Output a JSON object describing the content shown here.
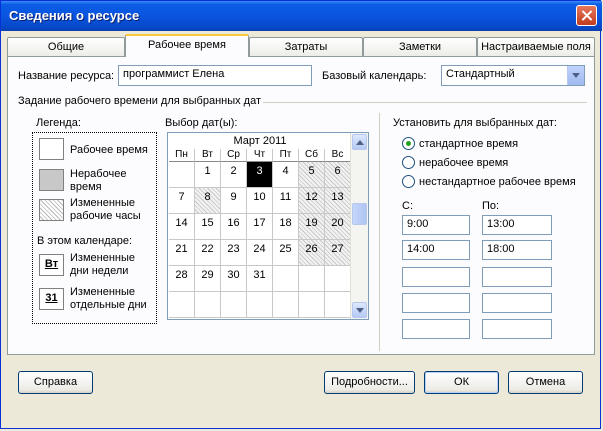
{
  "window": {
    "title": "Сведения о ресурсе"
  },
  "tabs": [
    {
      "label": "Общие"
    },
    {
      "label": "Рабочее время"
    },
    {
      "label": "Затраты"
    },
    {
      "label": "Заметки"
    },
    {
      "label": "Настраиваемые поля"
    }
  ],
  "resource": {
    "name_label": "Название ресурса:",
    "name_value": "программист Елена"
  },
  "base_calendar": {
    "label": "Базовый календарь:",
    "value": "Стандартный"
  },
  "section_title": "Задание рабочего времени для выбранных дат",
  "legend": {
    "title": "Легенда:",
    "items": [
      {
        "label_line1": "Рабочее время",
        "label_line2": ""
      },
      {
        "label_line1": "Нерабочее",
        "label_line2": "время"
      },
      {
        "label_line1": "Измененные",
        "label_line2": "рабочие часы"
      }
    ],
    "in_calendar": "В этом календаре:",
    "week_swatch_text": "Вт",
    "week_label_line1": "Измененные",
    "week_label_line2": "дни недели",
    "day_swatch_text": "31",
    "day_label_line1": "Измененные",
    "day_label_line2": "отдельные дни"
  },
  "calendar": {
    "label": "Выбор дат(ы):",
    "month": "Март 2011",
    "weekdays": [
      "Пн",
      "Вт",
      "Ср",
      "Чт",
      "Пт",
      "Сб",
      "Вс"
    ],
    "weeks": [
      [
        "",
        "1",
        "2",
        "3",
        "4",
        "5",
        "6"
      ],
      [
        "7",
        "8",
        "9",
        "10",
        "11",
        "12",
        "13"
      ],
      [
        "14",
        "15",
        "16",
        "17",
        "18",
        "19",
        "20"
      ],
      [
        "21",
        "22",
        "23",
        "24",
        "25",
        "26",
        "27"
      ],
      [
        "28",
        "29",
        "30",
        "31",
        "",
        "",
        ""
      ],
      [
        "",
        "",
        "",
        "",
        "",
        "",
        ""
      ]
    ],
    "selected": "3",
    "nonworking": [
      "8"
    ]
  },
  "set_for": {
    "title": "Установить для выбранных дат:",
    "options": [
      {
        "label": "стандартное время",
        "checked": true
      },
      {
        "label": "нерабочее время",
        "checked": false
      },
      {
        "label": "нестандартное рабочее время",
        "checked": false
      }
    ],
    "from_label": "С:",
    "to_label": "По:",
    "rows": [
      {
        "from": "9:00",
        "to": "13:00"
      },
      {
        "from": "14:00",
        "to": "18:00"
      },
      {
        "from": "",
        "to": ""
      },
      {
        "from": "",
        "to": ""
      },
      {
        "from": "",
        "to": ""
      }
    ]
  },
  "buttons": {
    "help": "Справка",
    "details": "Подробности...",
    "ok": "ОК",
    "cancel": "Отмена"
  }
}
